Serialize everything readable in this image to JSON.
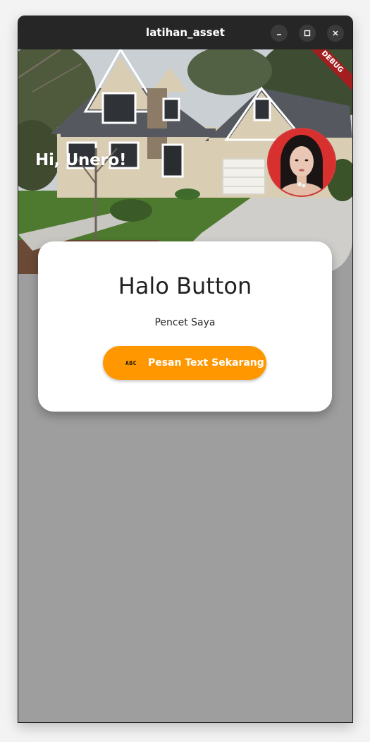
{
  "window": {
    "title": "latihan_asset",
    "minimize_icon": "minimize-icon",
    "maximize_icon": "maximize-icon",
    "close_icon": "close-icon"
  },
  "hero": {
    "image": "house-photo",
    "greeting": "Hi, Unero!",
    "avatar": "profile-photo",
    "debug_banner": "DEBUG"
  },
  "card": {
    "title": "Halo Button",
    "subtitle": "Pencet Saya",
    "button": {
      "icon": "abc-icon",
      "icon_text": "ABC",
      "label": "Pesan Text Sekarang"
    }
  },
  "colors": {
    "background": "#9e9e9e",
    "titlebar": "#262626",
    "button": "#ff9800",
    "card": "#ffffff",
    "debug_banner": "#a31e1e"
  }
}
